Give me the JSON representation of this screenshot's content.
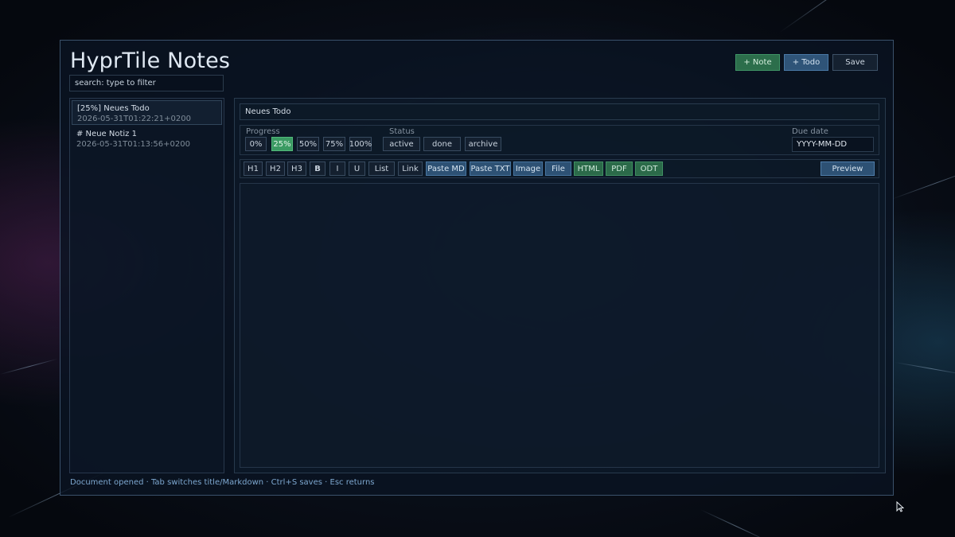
{
  "app": {
    "title": "HyprTile Notes",
    "search_placeholder": "search: type to filter"
  },
  "header": {
    "new_note_label": "+ Note",
    "new_todo_label": "+ Todo",
    "save_label": "Save"
  },
  "sidebar": {
    "items": [
      {
        "title": "[25%] Neues Todo",
        "date": "2026-05-31T01:22:21+0200",
        "selected": true
      },
      {
        "title": "# Neue Notiz 1",
        "date": "2026-05-31T01:13:56+0200",
        "selected": false
      }
    ]
  },
  "editor": {
    "title_value": "Neues Todo",
    "progress_label": "Progress",
    "progress_options": [
      "0%",
      "25%",
      "50%",
      "75%",
      "100%"
    ],
    "progress_selected": "25%",
    "status_label": "Status",
    "status_options": [
      "active",
      "done",
      "archive"
    ],
    "due_label": "Due date",
    "due_placeholder": "YYYY-MM-DD",
    "toolbar": {
      "h1": "H1",
      "h2": "H2",
      "h3": "H3",
      "bold": "B",
      "italic": "I",
      "underline": "U",
      "list": "List",
      "link": "Link",
      "paste_md": "Paste MD",
      "paste_txt": "Paste TXT",
      "image": "Image",
      "file": "File",
      "html": "HTML",
      "pdf": "PDF",
      "odt": "ODT",
      "preview": "Preview"
    },
    "body": ""
  },
  "status_bar": {
    "text": "Document opened · Tab switches title/Markdown · Ctrl+S saves · Esc returns"
  },
  "colors": {
    "accent_green": "#3a9a62",
    "accent_blue": "#2f5478",
    "status_text": "#7da7cf"
  }
}
